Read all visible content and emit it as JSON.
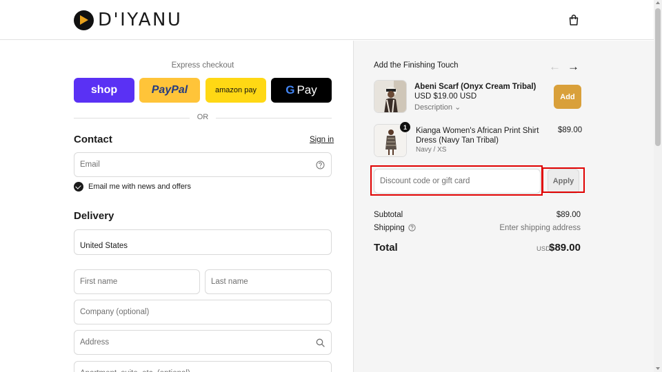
{
  "brand": {
    "name": "D'IYANU",
    "accent": "#e8a11c"
  },
  "header": {
    "cart_icon": "shopping-bag-icon"
  },
  "express": {
    "title": "Express checkout",
    "buttons": [
      {
        "label": "shop",
        "color": "#5a31f4"
      },
      {
        "label": "PayPal",
        "color": "#ffc439"
      },
      {
        "label": "amazon pay",
        "color": "#ffd814"
      },
      {
        "label": "Pay",
        "prefix": "G",
        "color": "#000000"
      }
    ],
    "or_label": "OR"
  },
  "contact": {
    "title": "Contact",
    "sign_in": "Sign in",
    "email_placeholder": "Email",
    "newsletter_label": "Email me with news and offers",
    "newsletter_checked": true
  },
  "delivery": {
    "title": "Delivery",
    "country": "United States",
    "first_name_placeholder": "First name",
    "last_name_placeholder": "Last name",
    "company_placeholder": "Company (optional)",
    "address_placeholder": "Address",
    "apartment_placeholder": "Apartment, suite, etc. (optional)"
  },
  "finishing": {
    "title": "Add the Finishing Touch",
    "upsell": {
      "name": "Abeni Scarf (Onyx Cream Tribal)",
      "price": "USD $19.00 USD",
      "description": "Description",
      "add_label": "Add"
    }
  },
  "cart": {
    "item": {
      "quantity": "1",
      "name": "Kianga Women's African Print Shirt Dress (Navy Tan Tribal)",
      "variant": "Navy / XS",
      "price": "$89.00"
    }
  },
  "discount": {
    "placeholder": "Discount code or gift card",
    "apply_label": "Apply"
  },
  "summary": {
    "subtotal_label": "Subtotal",
    "subtotal_value": "$89.00",
    "shipping_label": "Shipping",
    "shipping_value": "Enter shipping address",
    "total_label": "Total",
    "total_currency": "USD",
    "total_value": "$89.00"
  }
}
